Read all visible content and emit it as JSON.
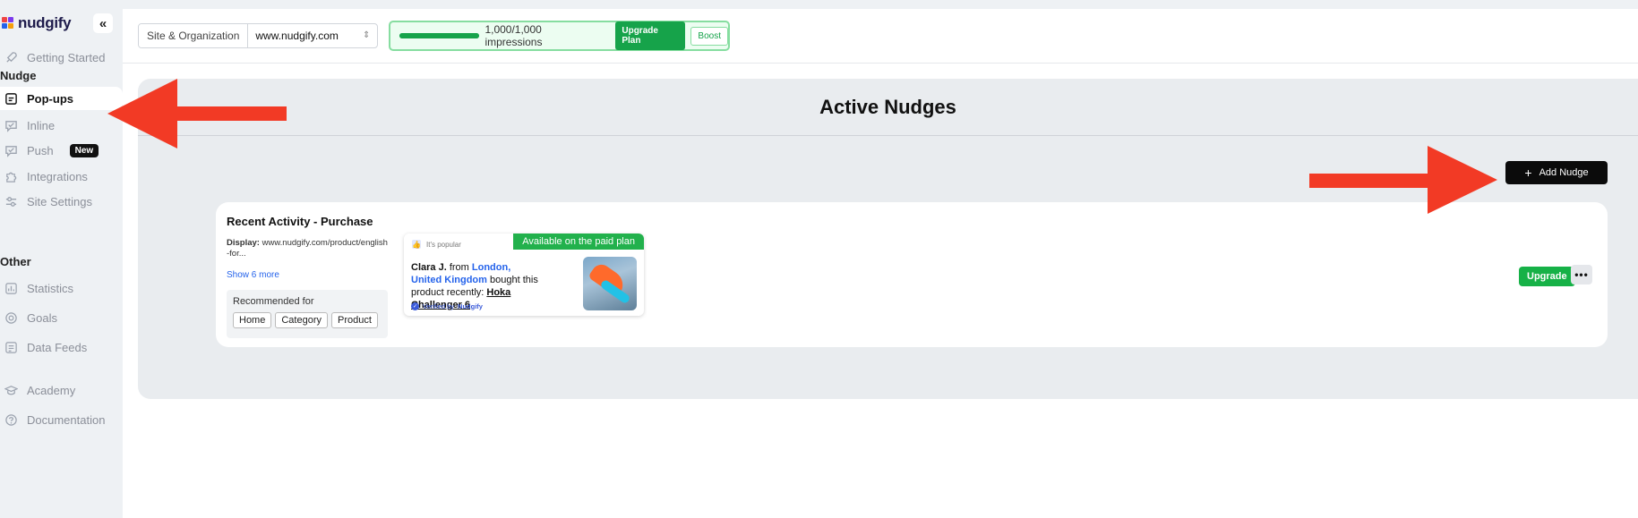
{
  "app": {
    "brand": "nudgify",
    "collapse_glyph": "«"
  },
  "sidebar": {
    "getting_started": "Getting Started",
    "section_nudge": "Nudge",
    "items": [
      {
        "label": "Pop-ups",
        "icon": "popup-icon",
        "active": true
      },
      {
        "label": "Inline",
        "icon": "inline-icon"
      },
      {
        "label": "Push",
        "icon": "push-icon",
        "badge": "New"
      },
      {
        "label": "Integrations",
        "icon": "puzzle-icon"
      },
      {
        "label": "Site Settings",
        "icon": "sliders-icon"
      }
    ],
    "section_other": "Other",
    "other_items": [
      {
        "label": "Statistics",
        "icon": "bar-chart-icon"
      },
      {
        "label": "Goals",
        "icon": "target-icon"
      },
      {
        "label": "Data Feeds",
        "icon": "database-icon"
      },
      {
        "label": "Academy",
        "icon": "graduation-cap-icon"
      },
      {
        "label": "Documentation",
        "icon": "help-circle-icon"
      }
    ]
  },
  "topbar": {
    "site_label": "Site & Organization",
    "site_value": "www.nudgify.com",
    "impressions_text": "1,000/1,000 impressions",
    "impressions_fraction": 1.0,
    "upgrade_plan": "Upgrade Plan",
    "boost": "Boost"
  },
  "main": {
    "title": "Active Nudges",
    "add_nudge": "Add Nudge"
  },
  "nudge_card": {
    "title": "Recent Activity - Purchase",
    "display_label": "Display:",
    "display_value": "www.nudgify.com/product/english-for...",
    "show_more": "Show 6 more",
    "recommended_for": "Recommended for",
    "tags": [
      "Home",
      "Category",
      "Product"
    ],
    "preview": {
      "popular": "It's popular",
      "paid_ribbon": "Available on the paid plan",
      "name": "Clara J.",
      "from": "from",
      "location": "London, United Kingdom",
      "bought": "bought this product recently:",
      "product": "Hoka Challenger 6",
      "verified_by": "Verified by",
      "verified_brand": "Nudgify"
    },
    "upgrade": "Upgrade",
    "more": "•••"
  },
  "colors": {
    "accent_green": "#16a34a",
    "annotation_red": "#f23a25",
    "link_blue": "#2563eb"
  }
}
